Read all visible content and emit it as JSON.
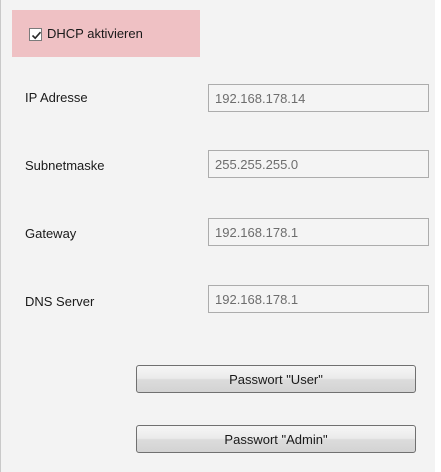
{
  "dhcp": {
    "label": "DHCP aktivieren",
    "checked": true
  },
  "fields": [
    {
      "label": "IP Adresse",
      "value": "192.168.178.14"
    },
    {
      "label": "Subnetmaske",
      "value": "255.255.255.0"
    },
    {
      "label": "Gateway",
      "value": "192.168.178.1"
    },
    {
      "label": "DNS Server",
      "value": "192.168.178.1"
    }
  ],
  "buttons": {
    "user_label": "Passwort \"User\"",
    "admin_label": "Passwort \"Admin\""
  },
  "colors": {
    "dhcp_highlight": "#efc1c4",
    "panel_background": "#f3f3f3"
  },
  "icons": {
    "checkbox_mark": "checkmark-icon"
  }
}
